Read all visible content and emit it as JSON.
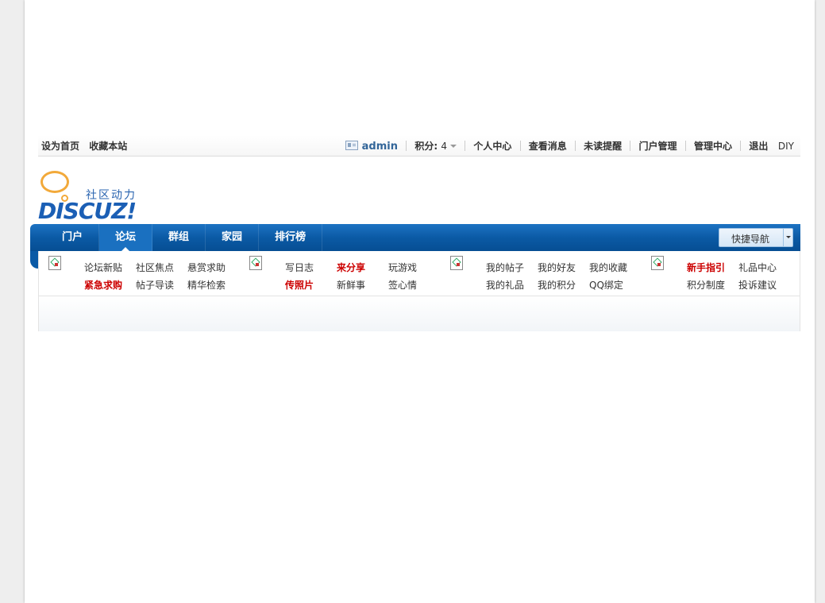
{
  "topbar": {
    "left": [
      "设为首页",
      "收藏本站"
    ],
    "username": "admin",
    "points_label": "积分:",
    "points_value": "4",
    "links": [
      "个人中心",
      "查看消息",
      "未读提醒",
      "门户管理",
      "管理中心",
      "退出"
    ],
    "diy": "DIY"
  },
  "logo": {
    "slogan": "社区动力",
    "text": "DISCUZ!"
  },
  "nav": {
    "items": [
      "门户",
      "论坛",
      "群组",
      "家园",
      "排行榜"
    ],
    "active_index": 1,
    "quick_nav": "快捷导航"
  },
  "submenu": {
    "groups": [
      {
        "links": [
          {
            "label": "论坛新贴",
            "red": false
          },
          {
            "label": "社区焦点",
            "red": false
          },
          {
            "label": "悬赏求助",
            "red": false
          },
          {
            "label": "紧急求购",
            "red": true
          },
          {
            "label": "帖子导读",
            "red": false
          },
          {
            "label": "精华检索",
            "red": false
          }
        ]
      },
      {
        "links": [
          {
            "label": "写日志",
            "red": false
          },
          {
            "label": "来分享",
            "red": true
          },
          {
            "label": "玩游戏",
            "red": false
          },
          {
            "label": "传照片",
            "red": true
          },
          {
            "label": "新鲜事",
            "red": false
          },
          {
            "label": "签心情",
            "red": false
          }
        ]
      },
      {
        "links": [
          {
            "label": "我的帖子",
            "red": false
          },
          {
            "label": "我的好友",
            "red": false
          },
          {
            "label": "我的收藏",
            "red": false
          },
          {
            "label": "我的礼品",
            "red": false
          },
          {
            "label": "我的积分",
            "red": false
          },
          {
            "label": "QQ绑定",
            "red": false
          }
        ]
      },
      {
        "links": [
          {
            "label": "新手指引",
            "red": true
          },
          {
            "label": "礼品中心",
            "red": false
          },
          {
            "label": "",
            "red": false
          },
          {
            "label": "积分制度",
            "red": false
          },
          {
            "label": "投诉建议",
            "red": false
          },
          {
            "label": "",
            "red": false
          }
        ]
      }
    ]
  },
  "colors": {
    "nav_blue": "#0b5aa5",
    "link_red": "#cc0000",
    "username_blue": "#336699",
    "logo_orange": "#f2a93a"
  }
}
